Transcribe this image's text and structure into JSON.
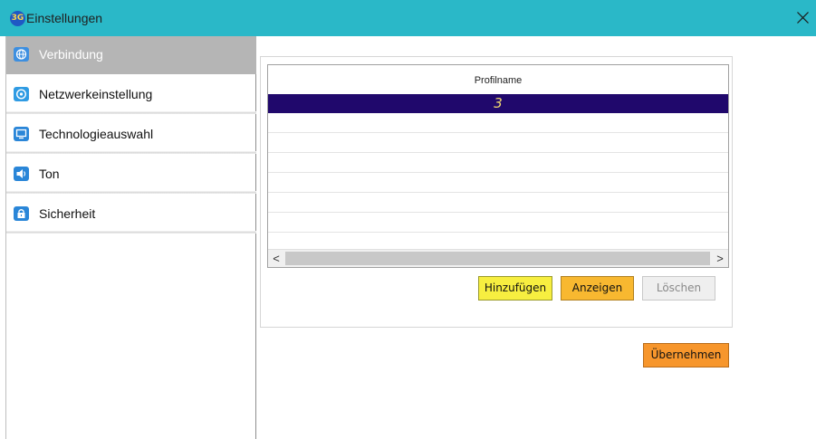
{
  "window": {
    "title": "Einstellungen",
    "app_icon_text": "3G",
    "accent_color": "#2ab8c8"
  },
  "sidebar": {
    "items": [
      {
        "label": "Verbindung",
        "icon": "globe-icon",
        "active": true
      },
      {
        "label": "Netzwerkeinstellung",
        "icon": "network-icon",
        "active": false
      },
      {
        "label": "Technologieauswahl",
        "icon": "monitor-icon",
        "active": false
      },
      {
        "label": "Ton",
        "icon": "speaker-icon",
        "active": false
      },
      {
        "label": "Sicherheit",
        "icon": "lock-icon",
        "active": false
      }
    ]
  },
  "profile_table": {
    "column_header": "Profilname",
    "rows": [
      "3"
    ],
    "selected_row_color": "#20086c"
  },
  "buttons": {
    "add_label": "Hinzufügen",
    "show_label": "Anzeigen",
    "delete_label": "Löschen",
    "apply_label": "Übernehmen"
  },
  "scrollbar": {
    "left_arrow": "<",
    "right_arrow": ">"
  }
}
